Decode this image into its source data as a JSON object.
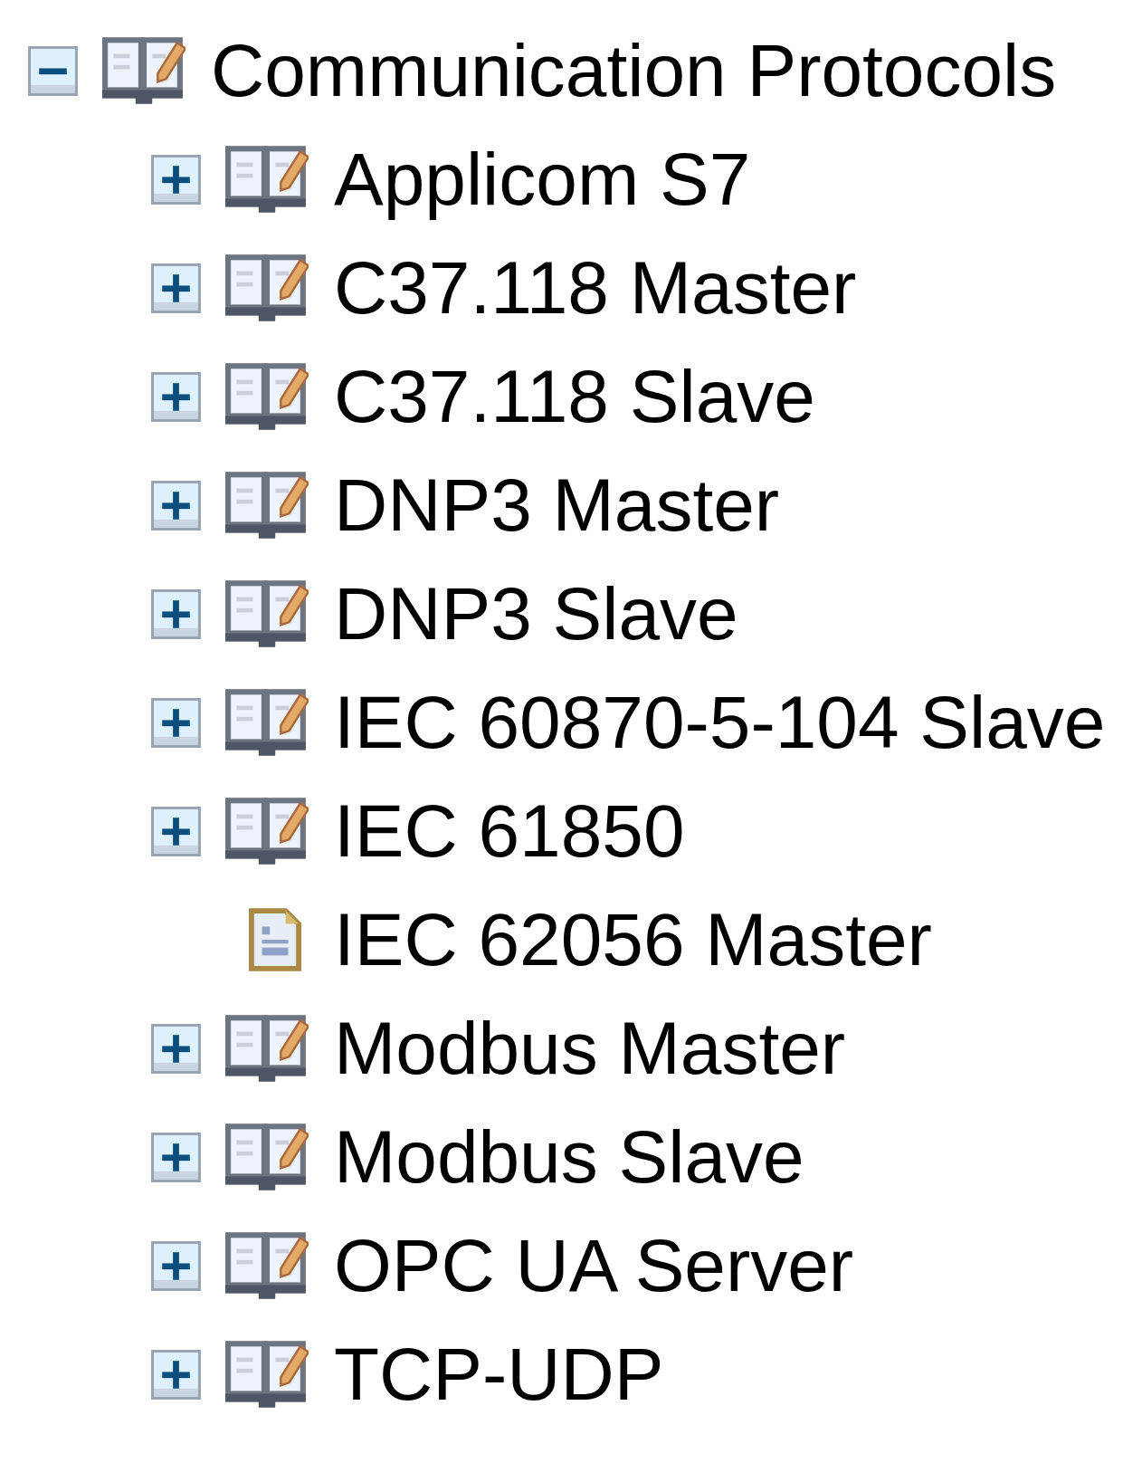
{
  "tree": {
    "label": "Communication Protocols",
    "kind": "folder",
    "expanded": true,
    "children": [
      {
        "label": "Applicom S7",
        "kind": "folder",
        "expanded": false
      },
      {
        "label": "C37.118 Master",
        "kind": "folder",
        "expanded": false
      },
      {
        "label": "C37.118 Slave",
        "kind": "folder",
        "expanded": false
      },
      {
        "label": "DNP3 Master",
        "kind": "folder",
        "expanded": false
      },
      {
        "label": "DNP3 Slave",
        "kind": "folder",
        "expanded": false
      },
      {
        "label": "IEC 60870-5-104 Slave",
        "kind": "folder",
        "expanded": false
      },
      {
        "label": "IEC 61850",
        "kind": "folder",
        "expanded": false
      },
      {
        "label": "IEC 62056 Master",
        "kind": "leaf"
      },
      {
        "label": "Modbus Master",
        "kind": "folder",
        "expanded": false
      },
      {
        "label": "Modbus Slave",
        "kind": "folder",
        "expanded": false
      },
      {
        "label": "OPC UA Server",
        "kind": "folder",
        "expanded": false
      },
      {
        "label": "TCP-UDP",
        "kind": "folder",
        "expanded": false
      }
    ]
  }
}
